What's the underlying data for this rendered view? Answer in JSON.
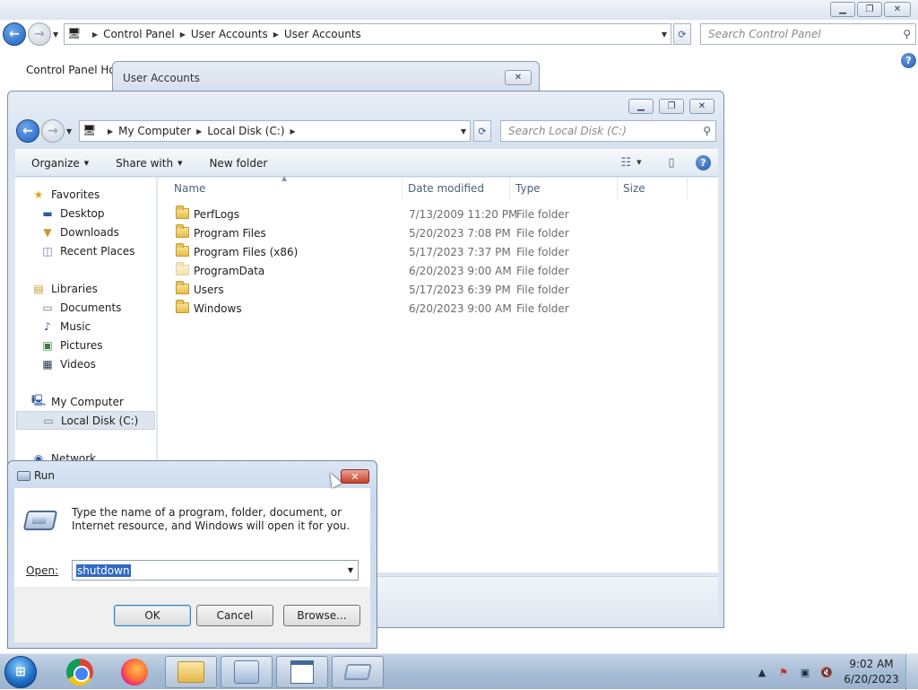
{
  "control_panel": {
    "breadcrumb": [
      "Control Panel",
      "User Accounts",
      "User Accounts"
    ],
    "search_placeholder": "Search Control Panel",
    "home_link": "Control Panel Hor"
  },
  "user_accounts_dialog": {
    "title": "User Accounts"
  },
  "explorer": {
    "breadcrumb": [
      "My Computer",
      "Local Disk (C:)"
    ],
    "search_placeholder": "Search Local Disk (C:)",
    "toolbar": {
      "organize": "Organize",
      "share_with": "Share with",
      "new_folder": "New folder"
    },
    "nav": {
      "favorites": "Favorites",
      "desktop": "Desktop",
      "downloads": "Downloads",
      "recent_places": "Recent Places",
      "libraries": "Libraries",
      "documents": "Documents",
      "music": "Music",
      "pictures": "Pictures",
      "videos": "Videos",
      "my_computer": "My Computer",
      "local_disk": "Local Disk (C:)",
      "network": "Network"
    },
    "columns": {
      "name": "Name",
      "date_modified": "Date modified",
      "type": "Type",
      "size": "Size"
    },
    "files": [
      {
        "name": "PerfLogs",
        "date": "7/13/2009 11:20 PM",
        "type": "File folder"
      },
      {
        "name": "Program Files",
        "date": "5/20/2023 7:08 PM",
        "type": "File folder"
      },
      {
        "name": "Program Files (x86)",
        "date": "5/17/2023 7:37 PM",
        "type": "File folder"
      },
      {
        "name": "ProgramData",
        "date": "6/20/2023 9:00 AM",
        "type": "File folder"
      },
      {
        "name": "Users",
        "date": "5/17/2023 6:39 PM",
        "type": "File folder"
      },
      {
        "name": "Windows",
        "date": "6/20/2023 9:00 AM",
        "type": "File folder"
      }
    ]
  },
  "run_dialog": {
    "title": "Run",
    "description": "Type the name of a program, folder, document, or Internet resource, and Windows will open it for you.",
    "open_label": "Open:",
    "open_value": "shutdown",
    "ok": "OK",
    "cancel": "Cancel",
    "browse": "Browse..."
  },
  "taskbar": {
    "time": "9:02 AM",
    "date": "6/20/2023",
    "apps": [
      "chrome-icon",
      "firefox-icon",
      "file-explorer-icon",
      "control-panel-icon",
      "document-icon",
      "run-icon"
    ]
  }
}
